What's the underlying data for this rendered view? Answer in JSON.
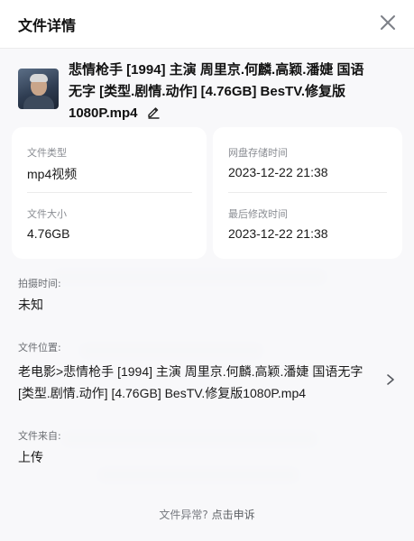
{
  "header": {
    "title": "文件详情"
  },
  "file": {
    "name": "悲情枪手 [1994] 主演 周里京.何麟.高颖.潘婕 国语无字 [类型.剧情.动作] [4.76GB] BesTV.修复版1080P.mp4"
  },
  "card_left": {
    "type_label": "文件类型",
    "type_value": "mp4视频",
    "size_label": "文件大小",
    "size_value": "4.76GB"
  },
  "card_right": {
    "stored_label": "网盘存储时间",
    "stored_value": "2023-12-22 21:38",
    "modified_label": "最后修改时间",
    "modified_value": "2023-12-22 21:38"
  },
  "shoot_time": {
    "label": "拍摄时间:",
    "value": "未知"
  },
  "location": {
    "label": "文件位置:",
    "value": "老电影>悲情枪手 [1994] 主演 周里京.何麟.高颖.潘婕 国语无字 [类型.剧情.动作] [4.76GB] BesTV.修复版1080P.mp4"
  },
  "source": {
    "label": "文件来自:",
    "value": "上传"
  },
  "footer": {
    "question": "文件异常?",
    "action": "点击申诉"
  },
  "icons": {
    "close": "close-icon",
    "edit": "pencil-icon",
    "chevron": "chevron-right-icon"
  }
}
